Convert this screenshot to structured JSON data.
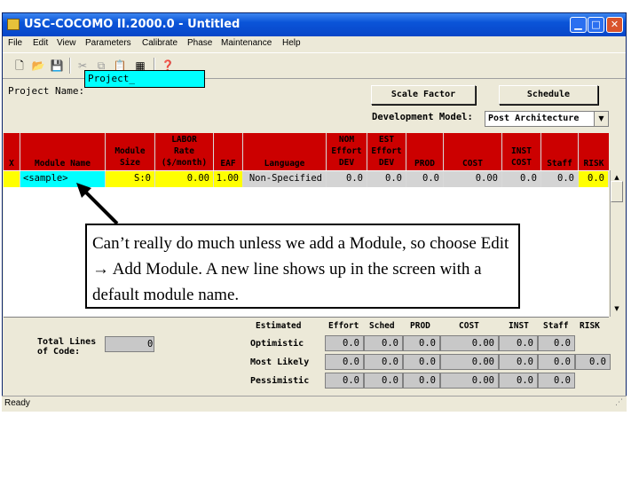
{
  "window": {
    "title": "USC-COCOMO II.2000.0 - Untitled"
  },
  "menu": [
    "File",
    "Edit",
    "View",
    "Parameters",
    "Calibrate",
    "Phase",
    "Maintenance",
    "Help"
  ],
  "toolbar_icons": [
    "new-icon",
    "open-icon",
    "save-icon",
    "cut-icon",
    "copy-icon",
    "paste-icon",
    "add-module-icon",
    "help-icon"
  ],
  "project": {
    "label": "Project Name:",
    "value": "Project_"
  },
  "buttons": {
    "scale_factor": "Scale Factor",
    "schedule": "Schedule"
  },
  "dev_model": {
    "label": "Development Model:",
    "value": "Post Architecture"
  },
  "grid": {
    "headers": {
      "x": [
        "X"
      ],
      "module_name": [
        "Module Name"
      ],
      "module_size": [
        "Module",
        "Size"
      ],
      "labor_rate": [
        "LABOR",
        "Rate",
        "($/month)"
      ],
      "eaf": [
        "EAF"
      ],
      "language": [
        "Language"
      ],
      "nom_effort": [
        "NOM",
        "Effort",
        "DEV"
      ],
      "est_effort": [
        "EST",
        "Effort",
        "DEV"
      ],
      "prod": [
        "PROD"
      ],
      "cost": [
        "COST"
      ],
      "inst_cost": [
        "INST",
        "COST"
      ],
      "staff": [
        "Staff"
      ],
      "risk": [
        "RISK"
      ]
    },
    "row": {
      "x": "",
      "module_name": "<sample>",
      "module_size": "S:0",
      "labor_rate": "0.00",
      "eaf": "1.00",
      "language": "Non-Specified",
      "nom_effort": "0.0",
      "est_effort": "0.0",
      "prod": "0.0",
      "cost": "0.00",
      "inst_cost": "0.0",
      "staff": "0.0",
      "risk": "0.0"
    }
  },
  "callout_text": "Can’t really do much unless we add a Module, so choose Edit → Add Module. A new line shows up in the screen with a default module name.",
  "estimates": {
    "headers": [
      "Estimated",
      "Effort",
      "Sched",
      "PROD",
      "COST",
      "INST",
      "Staff",
      "RISK"
    ],
    "total_lines_label": "Total Lines of Code:",
    "total_lines_value": "0",
    "rows": [
      {
        "label": "Optimistic",
        "values": [
          "0.0",
          "0.0",
          "0.0",
          "0.00",
          "0.0",
          "0.0"
        ],
        "risk": ""
      },
      {
        "label": "Most Likely",
        "values": [
          "0.0",
          "0.0",
          "0.0",
          "0.00",
          "0.0",
          "0.0"
        ],
        "risk": "0.0"
      },
      {
        "label": "Pessimistic",
        "values": [
          "0.0",
          "0.0",
          "0.0",
          "0.00",
          "0.0",
          "0.0"
        ],
        "risk": ""
      }
    ]
  },
  "status": "Ready",
  "colors": {
    "header_red": "#cc0000",
    "module_cyan": "#00ffff",
    "size_yellow": "#ffff00"
  }
}
